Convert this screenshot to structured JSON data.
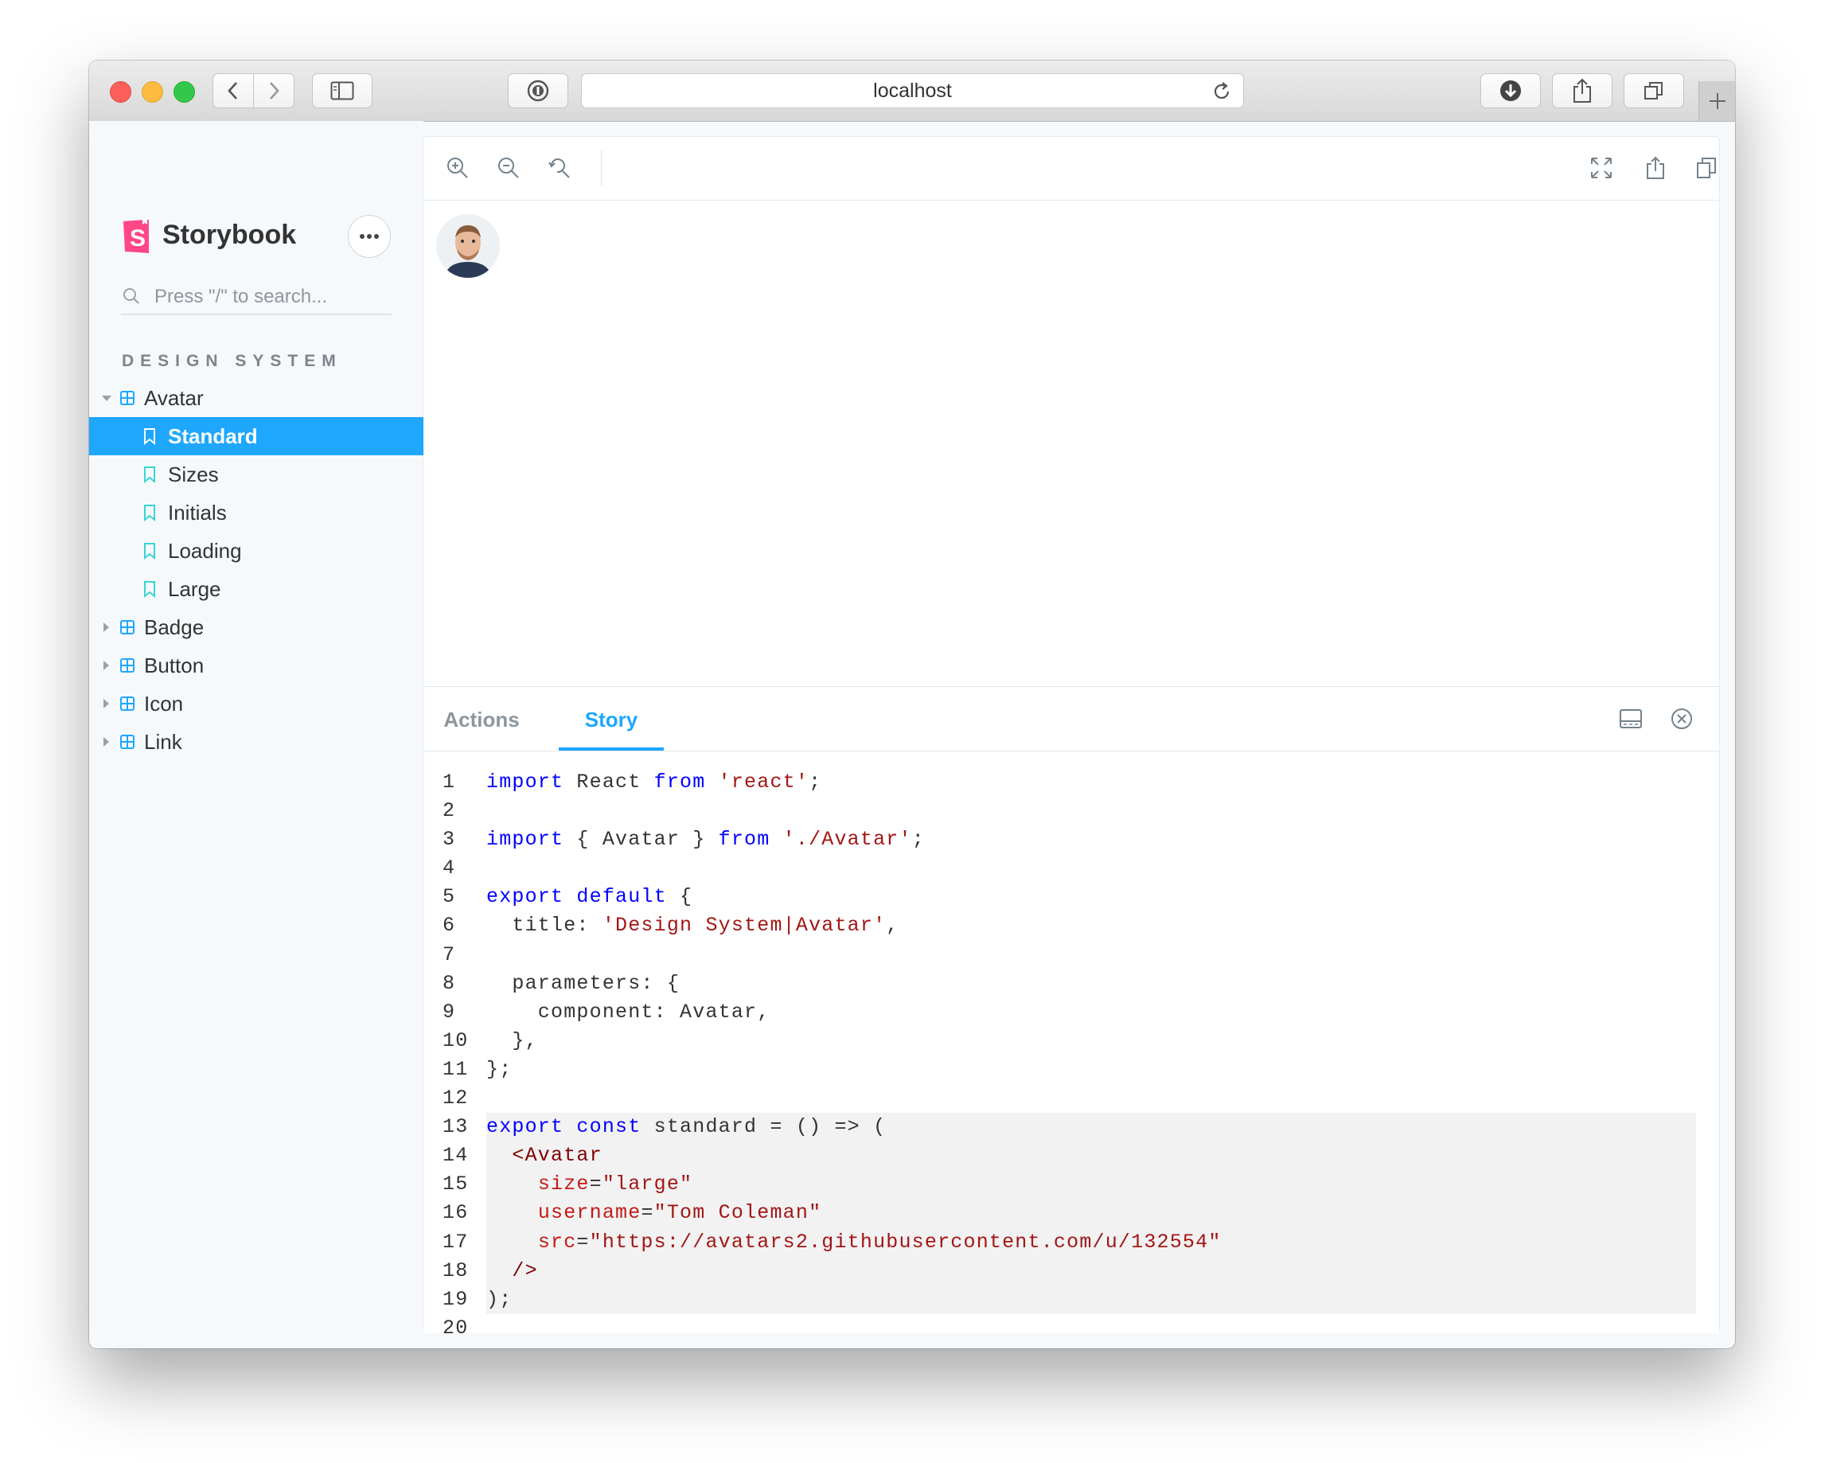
{
  "browser": {
    "url": "localhost",
    "traffic_colors": [
      "#fc605b",
      "#fdbc40",
      "#34c84a"
    ]
  },
  "sidebar": {
    "brand": "Storybook",
    "search_placeholder": "Press \"/\" to search...",
    "section_title": "DESIGN SYSTEM",
    "accent_color": "#1ea7fd",
    "brand_color": "#ff4785",
    "components": [
      {
        "label": "Avatar",
        "expanded": true
      },
      {
        "label": "Badge",
        "expanded": false
      },
      {
        "label": "Button",
        "expanded": false
      },
      {
        "label": "Icon",
        "expanded": false
      },
      {
        "label": "Link",
        "expanded": false
      }
    ],
    "avatar_stories": [
      {
        "label": "Standard",
        "selected": true
      },
      {
        "label": "Sizes",
        "selected": false
      },
      {
        "label": "Initials",
        "selected": false
      },
      {
        "label": "Loading",
        "selected": false
      },
      {
        "label": "Large",
        "selected": false
      }
    ]
  },
  "preview": {
    "tools": [
      "zoom-in-icon",
      "zoom-out-icon",
      "zoom-reset-icon",
      "fullscreen-icon",
      "share-icon",
      "copy-icon"
    ]
  },
  "addons": {
    "tabs": [
      {
        "label": "Actions",
        "active": false
      },
      {
        "label": "Story",
        "active": true
      }
    ],
    "code_lines": [
      {
        "n": "1",
        "hl": false,
        "tokens": [
          [
            "kw",
            "import"
          ],
          [
            "p",
            " React "
          ],
          [
            "kw",
            "from"
          ],
          [
            "p",
            " "
          ],
          [
            "str",
            "'react'"
          ],
          [
            "p",
            ";"
          ]
        ]
      },
      {
        "n": "2",
        "hl": false,
        "tokens": []
      },
      {
        "n": "3",
        "hl": false,
        "tokens": [
          [
            "kw",
            "import"
          ],
          [
            "p",
            " { Avatar } "
          ],
          [
            "kw",
            "from"
          ],
          [
            "p",
            " "
          ],
          [
            "str",
            "'./Avatar'"
          ],
          [
            "p",
            ";"
          ]
        ]
      },
      {
        "n": "4",
        "hl": false,
        "tokens": []
      },
      {
        "n": "5",
        "hl": false,
        "tokens": [
          [
            "kw",
            "export"
          ],
          [
            "p",
            " "
          ],
          [
            "kw",
            "default"
          ],
          [
            "p",
            " {"
          ]
        ]
      },
      {
        "n": "6",
        "hl": false,
        "tokens": [
          [
            "p",
            "  title: "
          ],
          [
            "str",
            "'Design System|Avatar'"
          ],
          [
            "p",
            ","
          ]
        ]
      },
      {
        "n": "7",
        "hl": false,
        "tokens": []
      },
      {
        "n": "8",
        "hl": false,
        "tokens": [
          [
            "p",
            "  parameters: {"
          ]
        ]
      },
      {
        "n": "9",
        "hl": false,
        "tokens": [
          [
            "p",
            "    component: Avatar,"
          ]
        ]
      },
      {
        "n": "10",
        "hl": false,
        "tokens": [
          [
            "p",
            "  },"
          ]
        ]
      },
      {
        "n": "11",
        "hl": false,
        "tokens": [
          [
            "p",
            "};"
          ]
        ]
      },
      {
        "n": "12",
        "hl": false,
        "tokens": []
      },
      {
        "n": "13",
        "hl": true,
        "tokens": [
          [
            "kw",
            "export"
          ],
          [
            "p",
            " "
          ],
          [
            "kw",
            "const"
          ],
          [
            "p",
            " standard = () => ("
          ]
        ]
      },
      {
        "n": "14",
        "hl": true,
        "tokens": [
          [
            "p",
            "  "
          ],
          [
            "tag",
            "<Avatar"
          ]
        ]
      },
      {
        "n": "15",
        "hl": true,
        "tokens": [
          [
            "p",
            "    "
          ],
          [
            "attr",
            "size"
          ],
          [
            "p",
            "="
          ],
          [
            "str",
            "\"large\""
          ]
        ]
      },
      {
        "n": "16",
        "hl": true,
        "tokens": [
          [
            "p",
            "    "
          ],
          [
            "attr",
            "username"
          ],
          [
            "p",
            "="
          ],
          [
            "str",
            "\"Tom Coleman\""
          ]
        ]
      },
      {
        "n": "17",
        "hl": true,
        "tokens": [
          [
            "p",
            "    "
          ],
          [
            "attr",
            "src"
          ],
          [
            "p",
            "="
          ],
          [
            "str",
            "\"https://avatars2.githubusercontent.com/u/132554\""
          ]
        ]
      },
      {
        "n": "18",
        "hl": true,
        "tokens": [
          [
            "p",
            "  "
          ],
          [
            "tag",
            "/>"
          ]
        ]
      },
      {
        "n": "19",
        "hl": true,
        "tokens": [
          [
            "p",
            ");"
          ]
        ]
      },
      {
        "n": "20",
        "hl": false,
        "tokens": []
      }
    ]
  }
}
